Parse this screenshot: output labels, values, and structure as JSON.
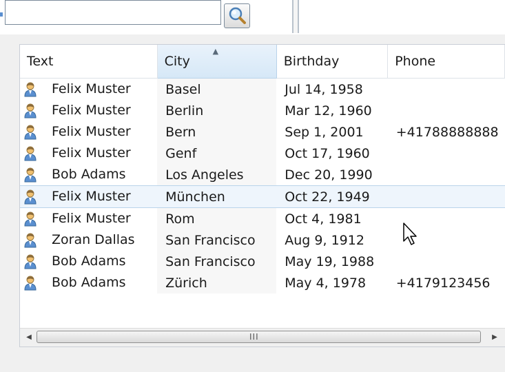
{
  "search": {
    "value": "",
    "placeholder": ""
  },
  "table": {
    "columns": [
      {
        "label": "Text"
      },
      {
        "label": "City",
        "sorted": "ascending"
      },
      {
        "label": "Birthday"
      },
      {
        "label": "Phone"
      }
    ],
    "rows": [
      {
        "name": "Felix Muster",
        "city": "Basel",
        "birthday": "Jul 14, 1958",
        "phone": ""
      },
      {
        "name": "Felix Muster",
        "city": "Berlin",
        "birthday": "Mar 12, 1960",
        "phone": ""
      },
      {
        "name": "Felix Muster",
        "city": "Bern",
        "birthday": "Sep 1, 2001",
        "phone": "+41788888888"
      },
      {
        "name": "Felix Muster",
        "city": "Genf",
        "birthday": "Oct 17, 1960",
        "phone": ""
      },
      {
        "name": "Bob Adams",
        "city": "Los Angeles",
        "birthday": "Dec 20, 1990",
        "phone": ""
      },
      {
        "name": "Felix Muster",
        "city": "München",
        "birthday": "Oct 22, 1949",
        "phone": "",
        "hovered": true
      },
      {
        "name": "Felix Muster",
        "city": "Rom",
        "birthday": "Oct 4, 1981",
        "phone": ""
      },
      {
        "name": "Zoran Dallas",
        "city": "San Francisco",
        "birthday": "Aug 9, 1912",
        "phone": ""
      },
      {
        "name": "Bob Adams",
        "city": "San Francisco",
        "birthday": "May 19, 1988",
        "phone": ""
      },
      {
        "name": "Bob Adams",
        "city": "Zürich",
        "birthday": "May 4, 1978",
        "phone": "+4179123456"
      }
    ]
  },
  "scrollbar": {
    "left_icon": "◀",
    "right_icon": "▶",
    "grip": "III"
  },
  "icons": {
    "search": "search-icon",
    "row": "user-icon"
  },
  "colors": {
    "hover_row": "#eef5fc",
    "sorted_header": "#d6e8f7",
    "accent": "#5a8fd0"
  }
}
